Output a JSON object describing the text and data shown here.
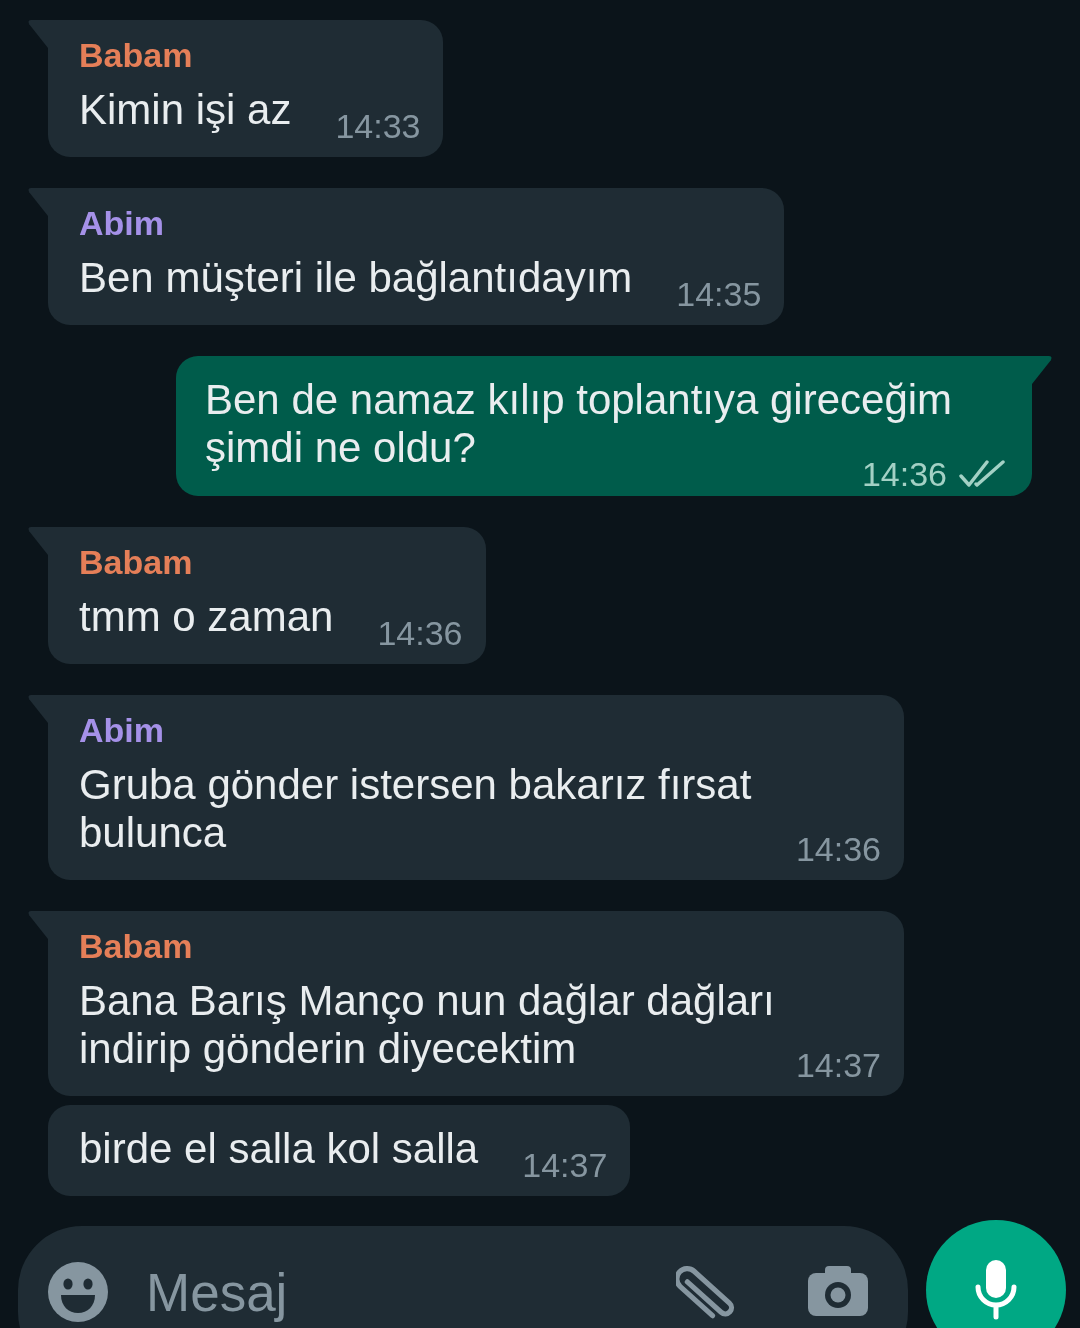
{
  "messages": [
    {
      "kind": "incoming",
      "sender": {
        "name": "Babam",
        "color": "#e57f58"
      },
      "text": "Kimin işi az",
      "time": "14:33"
    },
    {
      "kind": "incoming",
      "sender": {
        "name": "Abim",
        "color": "#a591e8"
      },
      "text": "Ben müşteri ile bağlantıdayım",
      "time": "14:35"
    },
    {
      "kind": "outgoing",
      "text": "Ben de namaz kılıp toplantıya gireceğim şimdi ne oldu?",
      "time": "14:36",
      "delivered": true,
      "read": false
    },
    {
      "kind": "incoming",
      "sender": {
        "name": "Babam",
        "color": "#e57f58"
      },
      "text": "tmm o zaman",
      "time": "14:36"
    },
    {
      "kind": "incoming",
      "sender": {
        "name": "Abim",
        "color": "#a591e8"
      },
      "text": "Gruba gönder istersen bakarız fırsat bulunca",
      "time": "14:36"
    },
    {
      "kind": "incoming",
      "sender": {
        "name": "Babam",
        "color": "#e57f58"
      },
      "text": "Bana Barış Manço nun dağlar dağları indirip gönderin diyecektim",
      "time": "14:37"
    },
    {
      "kind": "incoming",
      "text": "birde el salla kol salla",
      "time": "14:37"
    }
  ],
  "composer": {
    "placeholder": "Mesaj"
  }
}
